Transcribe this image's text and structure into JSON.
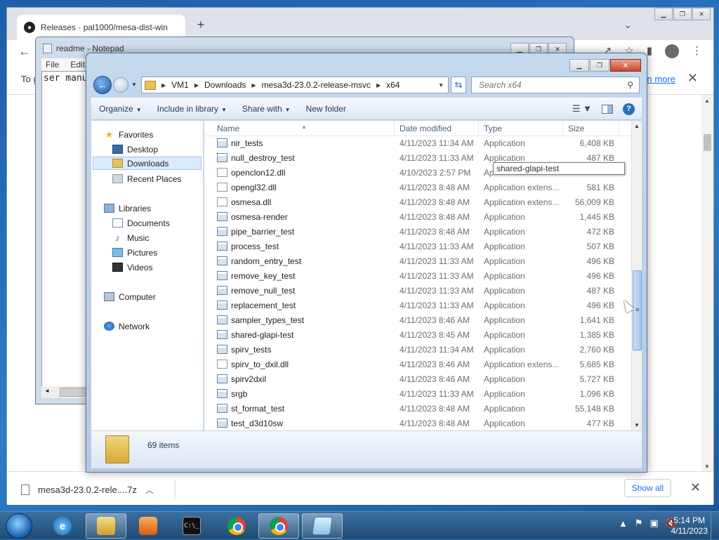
{
  "chrome": {
    "tab_title": "Releases · pal1000/mesa-dist-win",
    "new_tab_label": "+",
    "infobar_text": "To g",
    "infobar_link": "rn more",
    "download_file": "mesa3d-23.0.2-rele....7z",
    "show_all": "Show all"
  },
  "notepad": {
    "title": "readme - Notepad",
    "menu": [
      "File",
      "Edit"
    ],
    "content": "ser manu"
  },
  "explorer": {
    "breadcrumbs": [
      "VM1",
      "Downloads",
      "mesa3d-23.0.2-release-msvc",
      "x64"
    ],
    "search_placeholder": "Search x64",
    "commands": [
      "Organize",
      "Include in library",
      "Share with",
      "New folder"
    ],
    "nav": {
      "favorites": "Favorites",
      "desktop": "Desktop",
      "downloads": "Downloads",
      "recent": "Recent Places",
      "libraries": "Libraries",
      "documents": "Documents",
      "music": "Music",
      "pictures": "Pictures",
      "videos": "Videos",
      "computer": "Computer",
      "network": "Network"
    },
    "columns": {
      "name": "Name",
      "date": "Date modified",
      "type": "Type",
      "size": "Size"
    },
    "files": [
      {
        "name": "nir_tests",
        "date": "4/11/2023 11:34 AM",
        "type": "Application",
        "size": "6,408 KB",
        "kind": "exe"
      },
      {
        "name": "null_destroy_test",
        "date": "4/11/2023 11:33 AM",
        "type": "Application",
        "size": "487 KB",
        "kind": "exe"
      },
      {
        "name": "openclon12.dll",
        "date": "4/10/2023 2:57 PM",
        "type": "Ap",
        "size": "",
        "kind": "dll"
      },
      {
        "name": "opengl32.dll",
        "date": "4/11/2023 8:48 AM",
        "type": "Application extens...",
        "size": "581 KB",
        "kind": "dll"
      },
      {
        "name": "osmesa.dll",
        "date": "4/11/2023 8:48 AM",
        "type": "Application extens...",
        "size": "56,009 KB",
        "kind": "dll"
      },
      {
        "name": "osmesa-render",
        "date": "4/11/2023 8:48 AM",
        "type": "Application",
        "size": "1,445 KB",
        "kind": "exe"
      },
      {
        "name": "pipe_barrier_test",
        "date": "4/11/2023 8:48 AM",
        "type": "Application",
        "size": "472 KB",
        "kind": "exe"
      },
      {
        "name": "process_test",
        "date": "4/11/2023 11:33 AM",
        "type": "Application",
        "size": "507 KB",
        "kind": "exe"
      },
      {
        "name": "random_entry_test",
        "date": "4/11/2023 11:33 AM",
        "type": "Application",
        "size": "496 KB",
        "kind": "exe"
      },
      {
        "name": "remove_key_test",
        "date": "4/11/2023 11:33 AM",
        "type": "Application",
        "size": "496 KB",
        "kind": "exe"
      },
      {
        "name": "remove_null_test",
        "date": "4/11/2023 11:33 AM",
        "type": "Application",
        "size": "487 KB",
        "kind": "exe"
      },
      {
        "name": "replacement_test",
        "date": "4/11/2023 11:33 AM",
        "type": "Application",
        "size": "496 KB",
        "kind": "exe"
      },
      {
        "name": "sampler_types_test",
        "date": "4/11/2023 8:46 AM",
        "type": "Application",
        "size": "1,641 KB",
        "kind": "exe"
      },
      {
        "name": "shared-glapi-test",
        "date": "4/11/2023 8:45 AM",
        "type": "Application",
        "size": "1,385 KB",
        "kind": "exe"
      },
      {
        "name": "spirv_tests",
        "date": "4/11/2023 11:34 AM",
        "type": "Application",
        "size": "2,760 KB",
        "kind": "exe"
      },
      {
        "name": "spirv_to_dxil.dll",
        "date": "4/11/2023 8:46 AM",
        "type": "Application extens...",
        "size": "5,685 KB",
        "kind": "dll"
      },
      {
        "name": "spirv2dxil",
        "date": "4/11/2023 8:46 AM",
        "type": "Application",
        "size": "5,727 KB",
        "kind": "exe"
      },
      {
        "name": "srgb",
        "date": "4/11/2023 11:33 AM",
        "type": "Application",
        "size": "1,096 KB",
        "kind": "exe"
      },
      {
        "name": "st_format_test",
        "date": "4/11/2023 8:48 AM",
        "type": "Application",
        "size": "55,148 KB",
        "kind": "exe"
      },
      {
        "name": "test_d3d10sw",
        "date": "4/11/2023 8:48 AM",
        "type": "Application",
        "size": "477 KB",
        "kind": "exe"
      }
    ],
    "tooltip": "shared-glapi-test",
    "item_count": "69 items"
  },
  "taskbar": {
    "time": "5:14 PM",
    "date": "4/11/2023",
    "cmd_glyph": "C:\\_"
  }
}
